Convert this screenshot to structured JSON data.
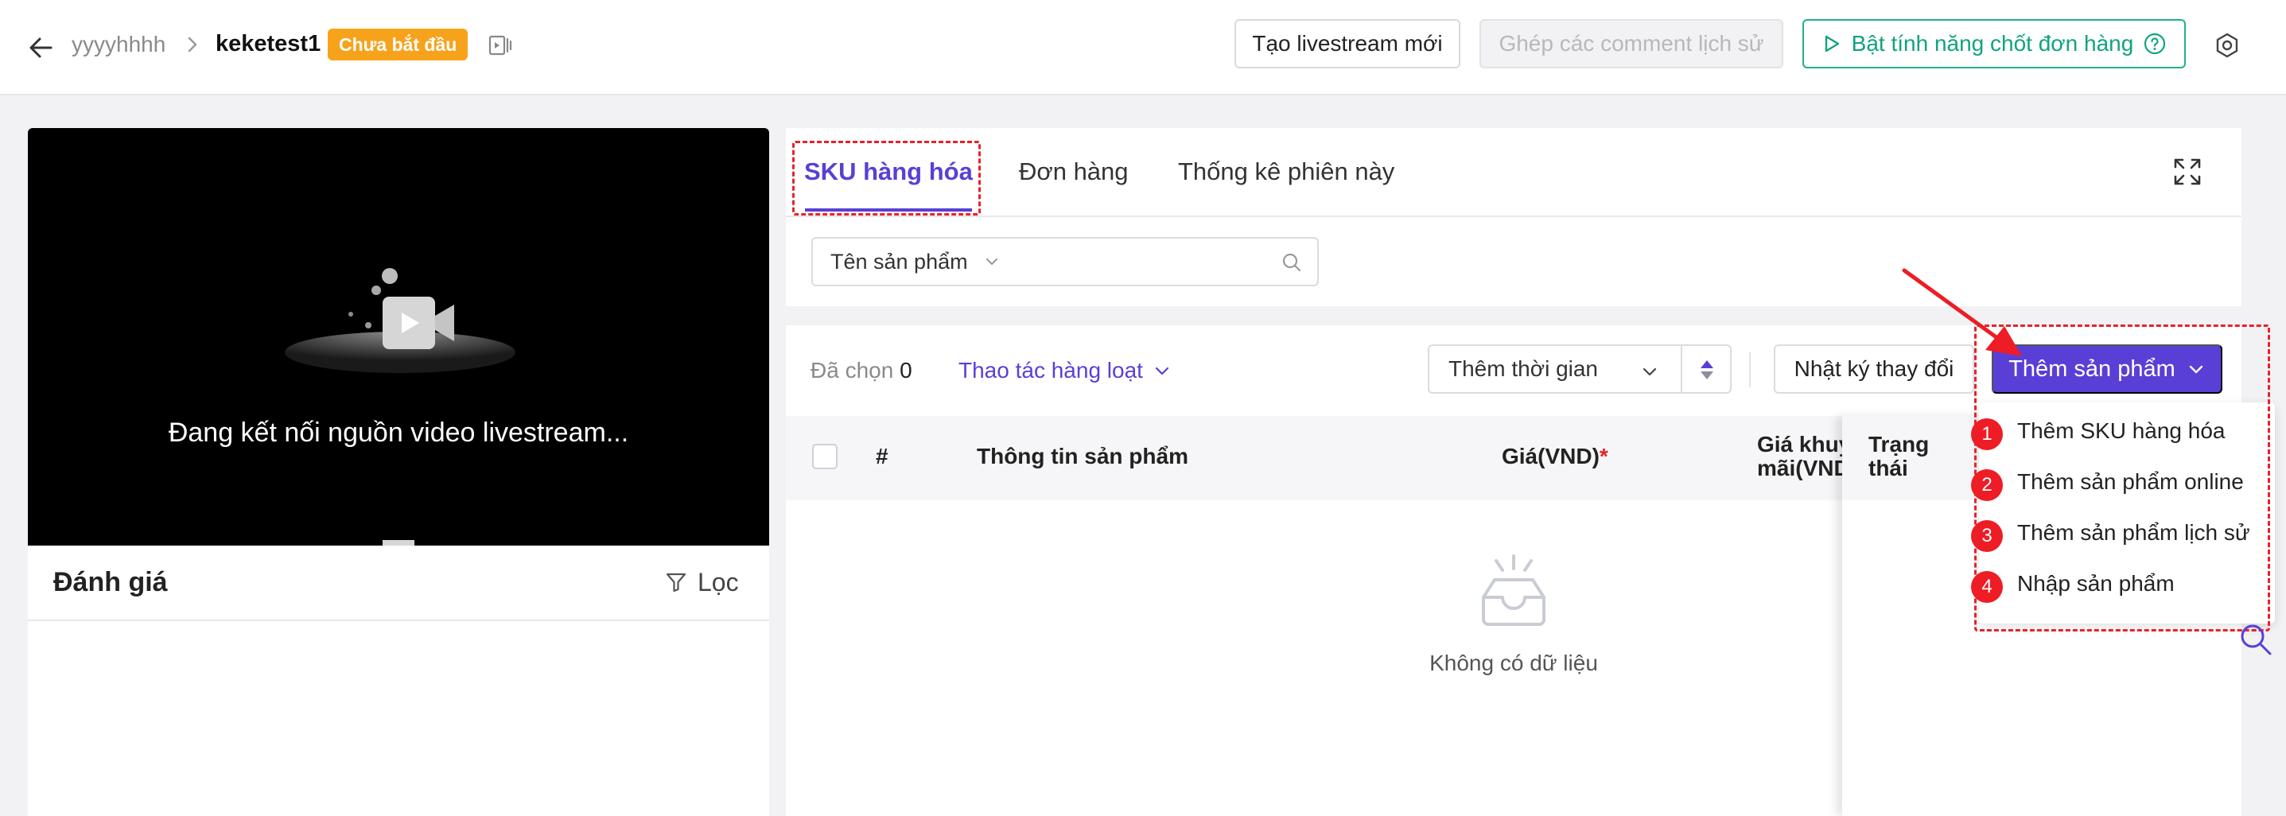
{
  "header": {
    "shop_name": "yyyyhhhh",
    "session_name": "keketest1",
    "status": "Chưa bắt đầu",
    "create_label": "Tạo livestream mới",
    "merge_label": "Ghép các comment lịch sử",
    "order_label": "Bật tính năng chốt đơn hàng"
  },
  "video": {
    "status": "Đang kết nối nguồn video livestream..."
  },
  "reviews": {
    "title": "Đánh giá",
    "filter_label": "Lọc"
  },
  "tabs": [
    {
      "label": "SKU hàng hóa",
      "active": true
    },
    {
      "label": "Đơn hàng",
      "active": false
    },
    {
      "label": "Thống kê phiên này",
      "active": false
    }
  ],
  "search": {
    "type_label": "Tên sản phẩm",
    "value": ""
  },
  "actions": {
    "selected_label": "Đã chọn",
    "selected_count": "0",
    "bulk_label": "Thao tác hàng loạt",
    "time_label": "Thêm thời gian",
    "log_label": "Nhật ký thay đổi",
    "add_label": "Thêm sản phẩm"
  },
  "table": {
    "headers": {
      "index": "#",
      "info": "Thông tin sản phẩm",
      "price": "Giá(VND)",
      "price_required": "*",
      "promo_line1": "Giá khuy",
      "promo_line2": "mãi(VND",
      "status_line1": "Trạng",
      "status_line2": "thái"
    },
    "empty_text": "Không có dữ liệu"
  },
  "dropdown": {
    "items": [
      {
        "num": "1",
        "label": "Thêm SKU hàng hóa"
      },
      {
        "num": "2",
        "label": "Thêm sản phẩm online"
      },
      {
        "num": "3",
        "label": "Thêm sản phẩm lịch sử"
      },
      {
        "num": "4",
        "label": "Nhập sản phẩm"
      }
    ]
  },
  "colors": {
    "accent": "#5a3fd6",
    "success": "#10a37f",
    "warning": "#f7a21b",
    "annotation": "#e8212b"
  }
}
